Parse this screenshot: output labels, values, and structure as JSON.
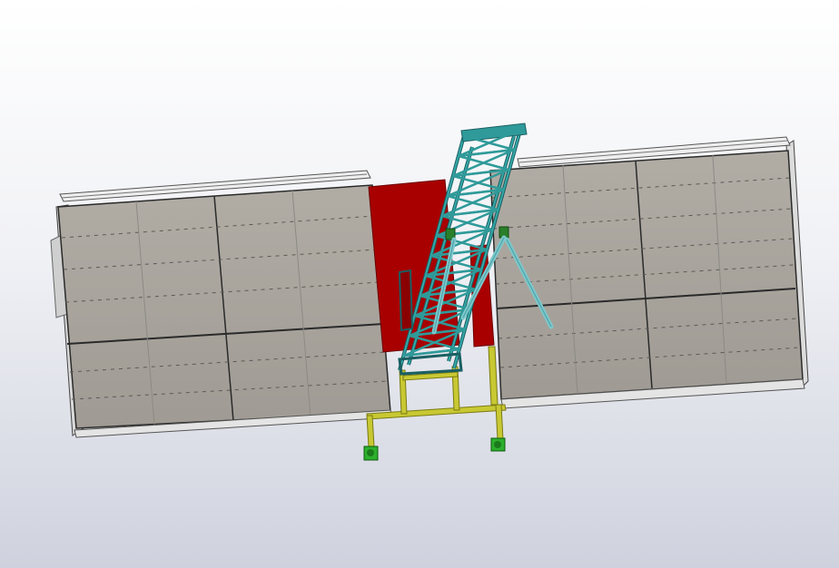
{
  "scene": {
    "background_top": "#ffffff",
    "background_bottom": "#cfd2de",
    "panel_fill": "#a7a39b",
    "panel_edge": "#2a2a2a",
    "rail_color": "#d8d8d8",
    "backplate_color": "#aa0000",
    "truss_color": "#2f9a99",
    "truss_dark": "#1a5f62",
    "brace_color": "#7cc8cc",
    "frame_color": "#c8c833",
    "foot_color": "#2db02d"
  },
  "objects": [
    {
      "name": "left-solar-panel-array",
      "icon": "solar-panel"
    },
    {
      "name": "right-solar-panel-array",
      "icon": "solar-panel"
    },
    {
      "name": "mounting-backplate",
      "icon": "plate"
    },
    {
      "name": "lattice-mast",
      "icon": "truss"
    },
    {
      "name": "support-frame",
      "icon": "frame"
    },
    {
      "name": "ground-feet",
      "icon": "foot"
    }
  ]
}
